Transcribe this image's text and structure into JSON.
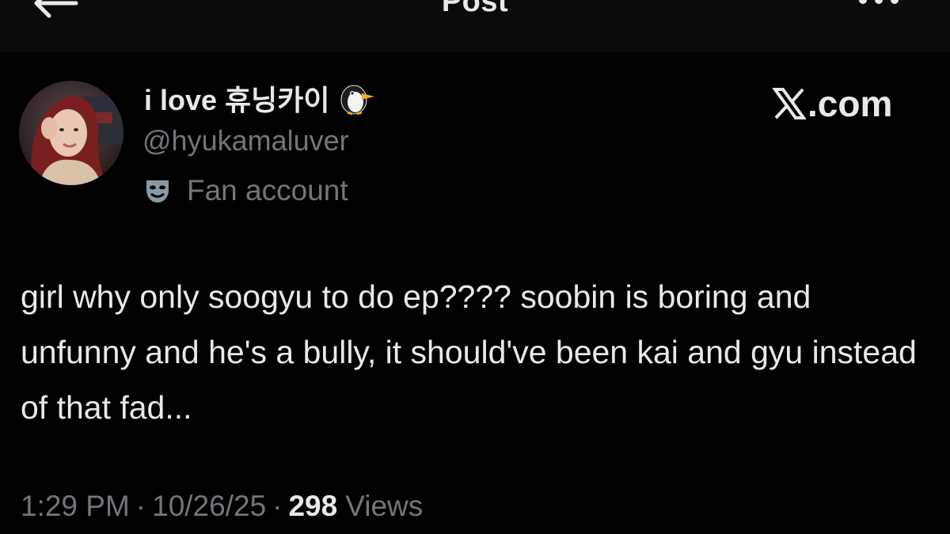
{
  "topbar": {
    "title": "Post",
    "back_icon": "arrow-left-icon",
    "more_icon": "more-horizontal-icon"
  },
  "author": {
    "display_name": "i love 휴닝카이",
    "name_emoji_icon": "penguin-icon",
    "handle": "@hyukamaluver",
    "label_icon": "performing-arts-mask-icon",
    "label": "Fan account"
  },
  "watermark": {
    "logo_icon": "x-logo-icon",
    "text": ".com"
  },
  "post": {
    "text": "girl why only soogyu to do ep???? soobin is boring and unfunny and he's a bully, it should've been kai and gyu instead of that fad..."
  },
  "meta": {
    "time": "1:29 PM",
    "separator": "·",
    "date": "10/26/25",
    "views_count": "298",
    "views_label": "Views"
  },
  "colors": {
    "background": "#000000",
    "topbar_background": "#0b0b0b",
    "primary_text": "#e7e9ea",
    "secondary_text": "#71767b"
  }
}
